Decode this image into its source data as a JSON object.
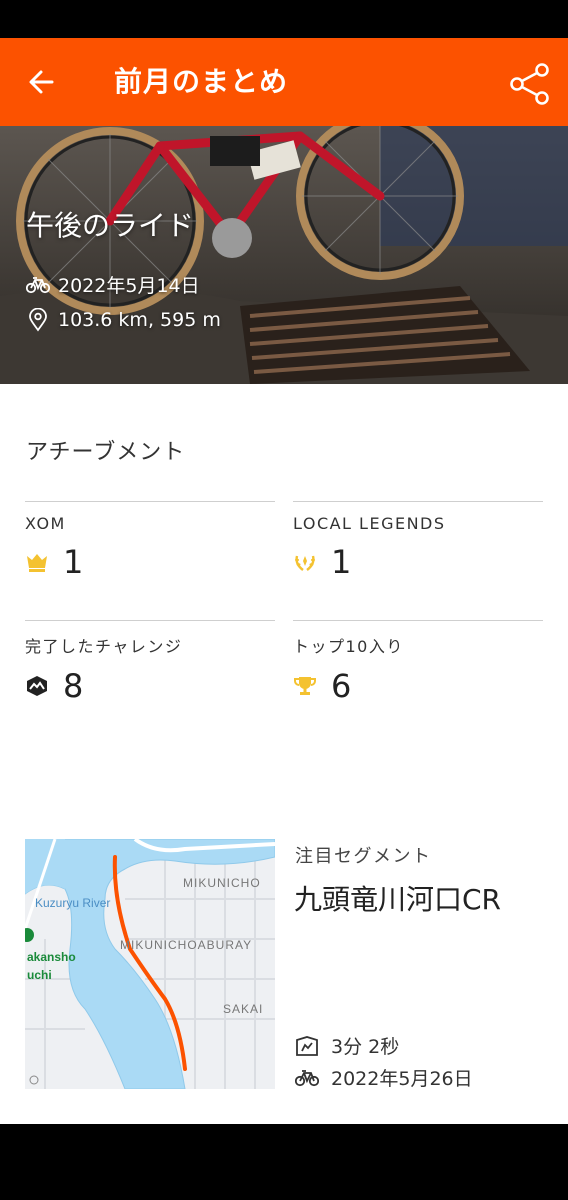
{
  "header": {
    "title": "前月のまとめ",
    "background_color": "#fc5200"
  },
  "activity": {
    "title": "午後のライド",
    "date": "2022年5月14日",
    "distance_elevation": "103.6 km, 595 m"
  },
  "achievements": {
    "section_title": "アチーブメント",
    "items": [
      {
        "label": "XOM",
        "value": "1",
        "icon": "crown-icon"
      },
      {
        "label": "LOCAL LEGENDS",
        "value": "1",
        "icon": "laurel-icon"
      },
      {
        "label": "完了したチャレンジ",
        "value": "8",
        "icon": "challenge-icon"
      },
      {
        "label": "トップ10入り",
        "value": "6",
        "icon": "trophy-icon"
      }
    ]
  },
  "segment": {
    "label": "注目セグメント",
    "name": "九頭竜川河口CR",
    "time": "3分 2秒",
    "date": "2022年5月26日",
    "map_labels": {
      "river": "Kuzuryu River",
      "area1": "MIKUNICHO",
      "area2": "MIKUNICHOABURAY",
      "area3": "SAKAI",
      "station1": "akansho",
      "station2": "uchi"
    },
    "route_color": "#fc5200"
  }
}
